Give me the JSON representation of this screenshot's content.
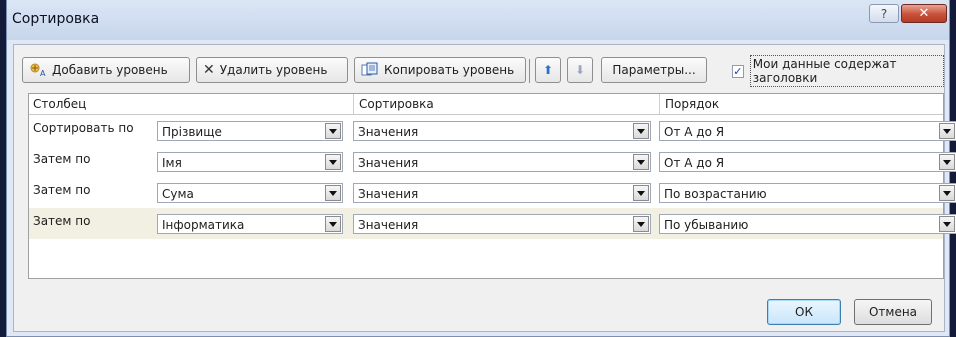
{
  "window": {
    "title": "Сортировка",
    "help_glyph": "?",
    "close_glyph": "✕"
  },
  "toolbar": {
    "add_level": "Добавить уровень",
    "delete_level": "Удалить уровень",
    "copy_level": "Копировать уровень",
    "options": "Параметры...",
    "move_up_glyph": "⬆",
    "move_down_glyph": "⬇",
    "delete_glyph": "✕",
    "has_headers_label": "Мои данные содержат заголовки",
    "has_headers_checked": "✓"
  },
  "grid": {
    "headers": {
      "column": "Столбец",
      "sort_on": "Сортировка",
      "order": "Порядок"
    },
    "rows": [
      {
        "label": "Сортировать по",
        "column": "Прізвище",
        "sort_on": "Значения",
        "order": "От А до Я"
      },
      {
        "label": "Затем по",
        "column": "Імя",
        "sort_on": "Значения",
        "order": "От А до Я"
      },
      {
        "label": "Затем по",
        "column": "Сума",
        "sort_on": "Значения",
        "order": "По возрастанию"
      },
      {
        "label": "Затем по",
        "column": "Інформатика",
        "sort_on": "Значения",
        "order": "По убыванию"
      }
    ]
  },
  "footer": {
    "ok": "ОК",
    "cancel": "Отмена"
  },
  "colors": {
    "selected_row": "#f2efe3",
    "title_bar": "#dbe6f5",
    "close_button": "#c8513a"
  }
}
